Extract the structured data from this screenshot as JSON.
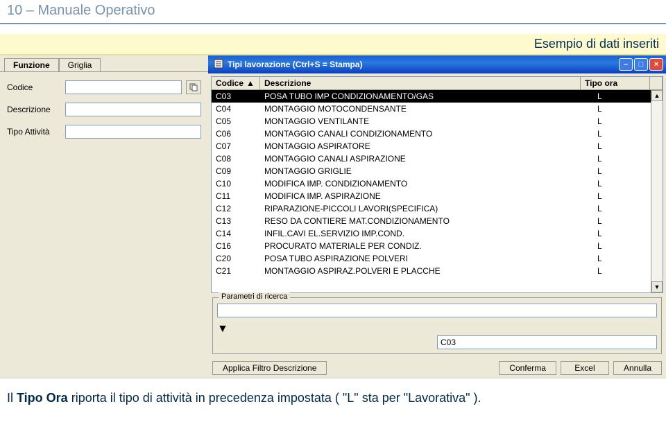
{
  "page_header": "10 – Manuale Operativo",
  "highlight": "Esempio di dati inseriti",
  "left_panel": {
    "tabs": [
      "Funzione",
      "Griglia"
    ],
    "fields": {
      "codice_label": "Codice",
      "descrizione_label": "Descrizione",
      "tipo_attivita_label": "Tipo Attività",
      "codice_value": "",
      "descrizione_value": "",
      "tipo_attivita_value": ""
    },
    "copy_icon_name": "copy-icon"
  },
  "right_window": {
    "title": "Tipi lavorazione (Ctrl+S = Stampa)",
    "columns": {
      "codice": "Codice",
      "descrizione": "Descrizione",
      "tipo_ora": "Tipo ora"
    },
    "rows": [
      {
        "code": "C03",
        "desc": "POSA TUBO IMP CONDIZIONAMENTO/GAS",
        "tipo": "L",
        "selected": true
      },
      {
        "code": "C04",
        "desc": "MONTAGGIO MOTOCONDENSANTE",
        "tipo": "L"
      },
      {
        "code": "C05",
        "desc": "MONTAGGIO VENTILANTE",
        "tipo": "L"
      },
      {
        "code": "C06",
        "desc": "MONTAGGIO CANALI CONDIZIONAMENTO",
        "tipo": "L"
      },
      {
        "code": "C07",
        "desc": "MONTAGGIO ASPIRATORE",
        "tipo": "L"
      },
      {
        "code": "C08",
        "desc": "MONTAGGIO CANALI ASPIRAZIONE",
        "tipo": "L"
      },
      {
        "code": "C09",
        "desc": "MONTAGGIO GRIGLIE",
        "tipo": "L"
      },
      {
        "code": "C10",
        "desc": "MODIFICA IMP. CONDIZIONAMENTO",
        "tipo": "L"
      },
      {
        "code": "C11",
        "desc": "MODIFICA IMP. ASPIRAZIONE",
        "tipo": "L"
      },
      {
        "code": "C12",
        "desc": "RIPARAZIONE-PICCOLI LAVORI(SPECIFICA)",
        "tipo": "L"
      },
      {
        "code": "C13",
        "desc": "RESO DA CONTIERE MAT.CONDIZIONAMENTO",
        "tipo": "L"
      },
      {
        "code": "C14",
        "desc": "INFIL.CAVI EL.SERVIZIO IMP.COND.",
        "tipo": "L"
      },
      {
        "code": "C16",
        "desc": "PROCURATO MATERIALE PER CONDIZ.",
        "tipo": "L"
      },
      {
        "code": "C20",
        "desc": "POSA TUBO ASPIRAZIONE POLVERI",
        "tipo": "L"
      },
      {
        "code": "C21",
        "desc": "MONTAGGIO ASPIRAZ.POLVERI E PLACCHE",
        "tipo": "L"
      }
    ],
    "search": {
      "legend": "Parametri di ricerca",
      "input_value": "",
      "filter_value": "C03"
    },
    "buttons": {
      "applica": "Applica Filtro Descrizione",
      "conferma": "Conferma",
      "excel": "Excel",
      "annulla": "Annulla"
    }
  },
  "foot_text_parts": {
    "p1": "Il ",
    "p2": "Tipo Ora",
    "p3": " riporta il tipo di attività in precedenza impostata ( \"L\" sta per \"Lavorativa\" )."
  }
}
